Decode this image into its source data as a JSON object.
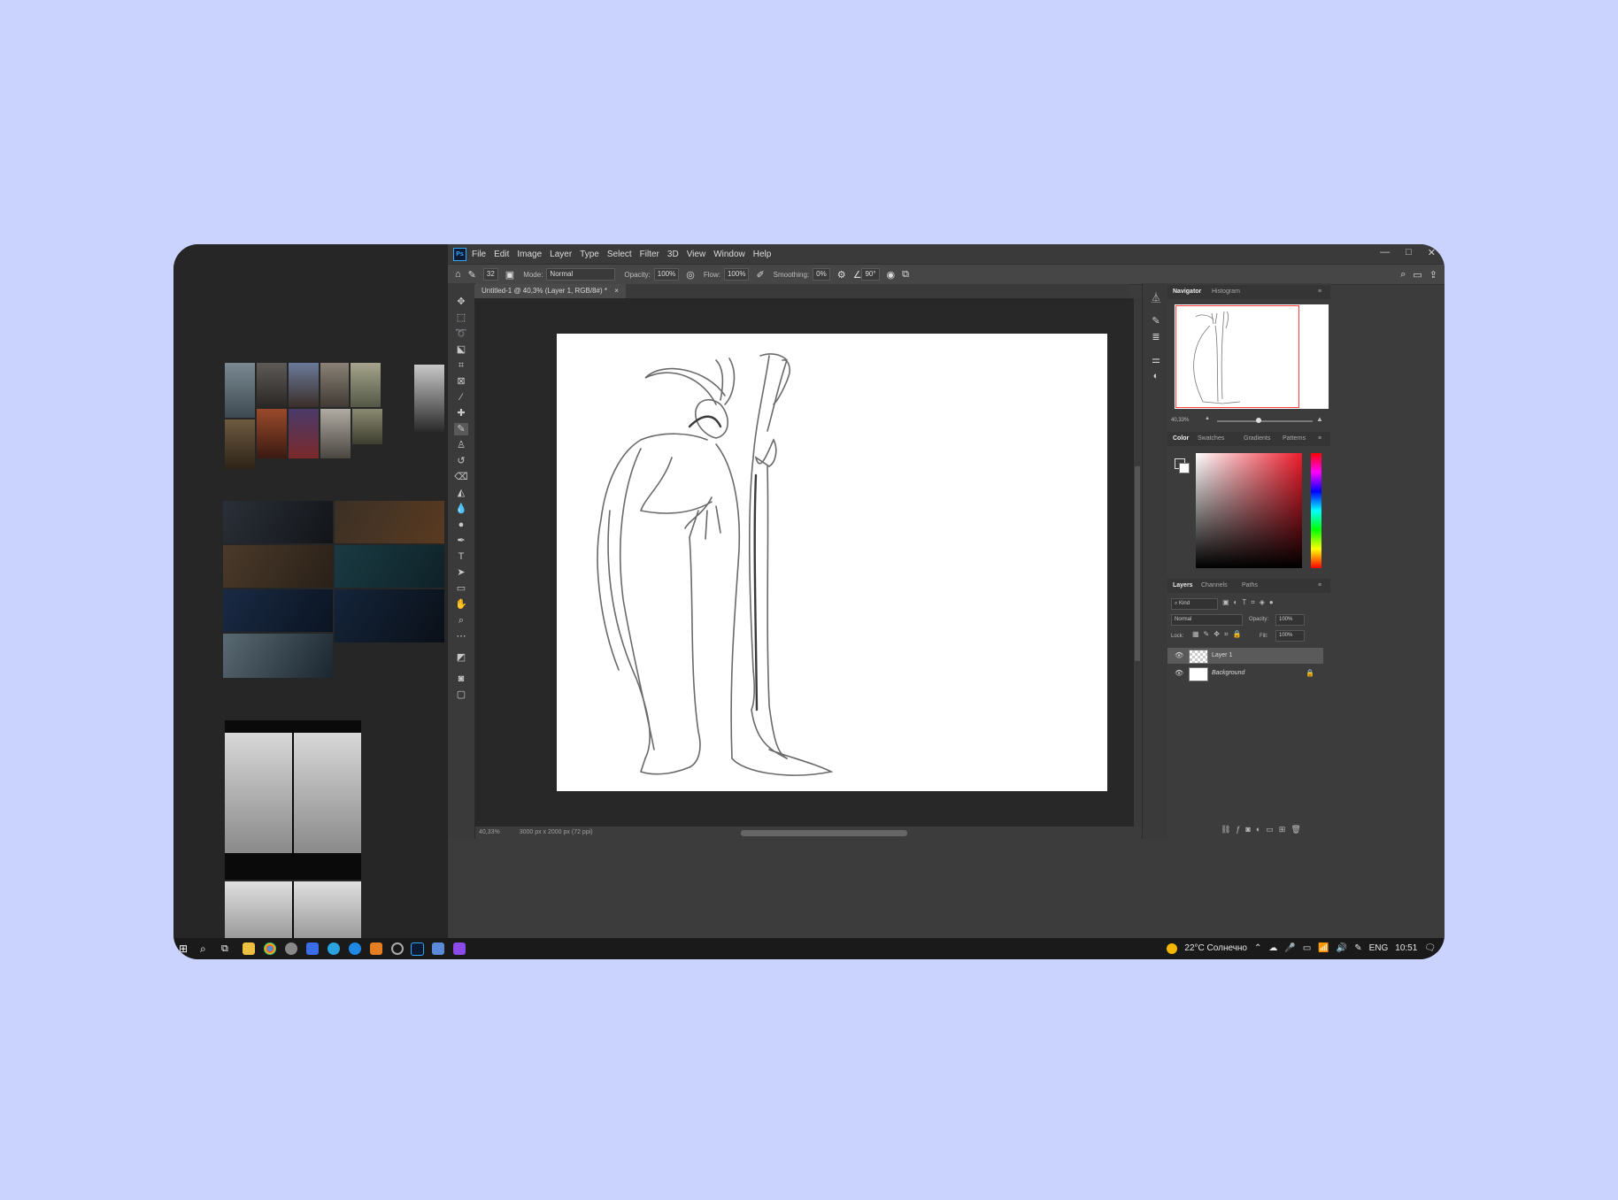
{
  "menu": {
    "app_logo": "Ps",
    "items": [
      "File",
      "Edit",
      "Image",
      "Layer",
      "Type",
      "Select",
      "Filter",
      "3D",
      "View",
      "Window",
      "Help"
    ],
    "window_controls": [
      "—",
      "□",
      "✕"
    ]
  },
  "options_bar": {
    "brush_size": "32",
    "mode_label": "Mode:",
    "mode_value": "Normal",
    "opacity_label": "Opacity:",
    "opacity_value": "100%",
    "flow_label": "Flow:",
    "flow_value": "100%",
    "smoothing_label": "Smoothing:",
    "smoothing_value": "0%",
    "angle_value": "90°"
  },
  "document": {
    "tab_title": "Untitled-1 @ 40,3% (Layer 1, RGB/8#) *",
    "tab_close": "×",
    "zoom_status": "40,33%",
    "size_status": "3000 px x 2000 px (72 ppi)"
  },
  "navigator": {
    "tabs": [
      "Navigator",
      "Histogram"
    ],
    "zoom": "40,33%"
  },
  "color_panel": {
    "tabs": [
      "Color",
      "Swatches",
      "Gradients",
      "Patterns"
    ],
    "accent_color": "#ee1c2b"
  },
  "layers_panel": {
    "tabs": [
      "Layers",
      "Channels",
      "Paths"
    ],
    "filter_label": "Kind",
    "blend_mode": "Normal",
    "opacity_label": "Opacity:",
    "opacity_value": "100%",
    "lock_label": "Lock:",
    "fill_label": "Fill:",
    "fill_value": "100%",
    "layers": [
      {
        "name": "Layer 1",
        "selected": true
      },
      {
        "name": "Background",
        "selected": false
      }
    ]
  },
  "taskbar": {
    "weather": "22°C Солнечно",
    "language": "ENG",
    "time": "10:51"
  }
}
